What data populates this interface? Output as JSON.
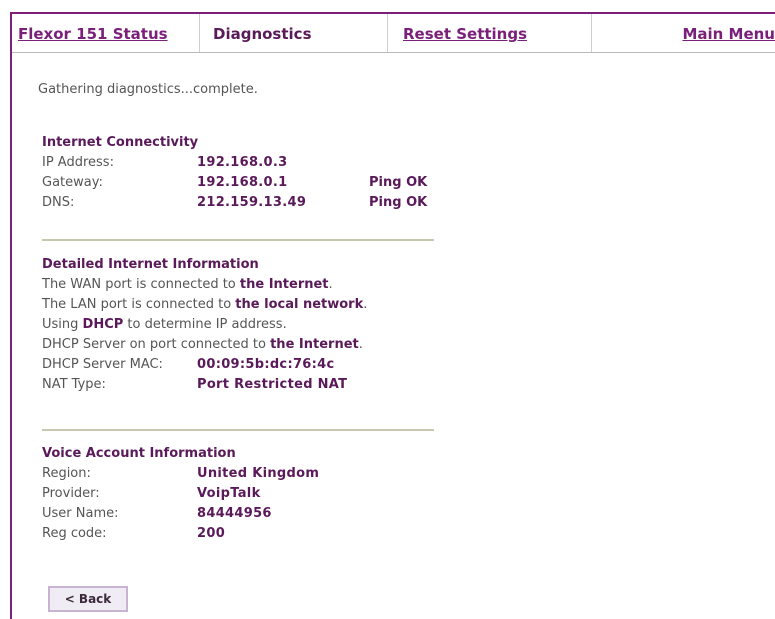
{
  "nav": {
    "status_label": "Flexor 151 Status",
    "diagnostics_label": "Diagnostics",
    "reset_label": "Reset Settings",
    "main_menu_label": "Main Menu"
  },
  "status_message": "Gathering diagnostics...complete.",
  "internet_connectivity": {
    "heading": "Internet Connectivity",
    "rows": [
      {
        "label": "IP Address:",
        "value": "192.168.0.3",
        "ping": ""
      },
      {
        "label": "Gateway:",
        "value": "192.168.0.1",
        "ping": "Ping OK"
      },
      {
        "label": "DNS:",
        "value": "212.159.13.49",
        "ping": "Ping OK"
      }
    ]
  },
  "detailed_info": {
    "heading": "Detailed Internet Information",
    "wan_prefix": "The WAN port is connected to ",
    "wan_bold": "the Internet",
    "wan_suffix": ".",
    "lan_prefix": "The LAN port is connected to ",
    "lan_bold": "the local network",
    "lan_suffix": ".",
    "dhcp_prefix": "Using ",
    "dhcp_bold": "DHCP",
    "dhcp_suffix": " to determine IP address.",
    "server_prefix": "DHCP Server on port connected to ",
    "server_bold": "the Internet",
    "server_suffix": ".",
    "mac_label": "DHCP Server MAC:",
    "mac_value": "00:09:5b:dc:76:4c",
    "nat_label": "NAT Type:",
    "nat_value": "Port Restricted NAT"
  },
  "voice_account": {
    "heading": "Voice Account Information",
    "rows": [
      {
        "label": "Region:",
        "value": "United Kingdom"
      },
      {
        "label": "Provider:",
        "value": "VoipTalk"
      },
      {
        "label": "User Name:",
        "value": "84444956"
      },
      {
        "label": "Reg code:",
        "value": "200"
      }
    ]
  },
  "back_button_label": "< Back"
}
